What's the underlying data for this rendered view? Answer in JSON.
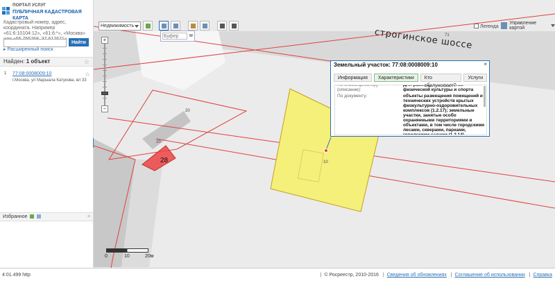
{
  "header": {
    "portal_label": "ПОРТАЛ УСЛУГ",
    "map_title": "ПУБЛИЧНАЯ КАДАСТРОВАЯ КАРТА"
  },
  "search": {
    "hint": "Кадастровый номер, адрес, координата. Например «61:6:10104:12», «61:6:*», «Москва» или «55.755768, 37.617671»",
    "value": "",
    "button_label": "Найти",
    "advanced_label": "Расширенный поиск"
  },
  "results": {
    "found_prefix": "Найден:",
    "found_count": "1 объект",
    "items": [
      {
        "index": "1",
        "cadastral_number": "77:08:0008009:10",
        "address": "г.Москва, ул Маршала Катукова, вл 33"
      }
    ]
  },
  "favorites": {
    "label": "Избранное"
  },
  "toolbar": {
    "layer_select_value": "Недвижимость",
    "buffer_placeholder": "Буфер",
    "buffer_unit": "м"
  },
  "map_controls": {
    "legend_label": "Легенда",
    "management_label": "Управление картой",
    "zoom_in": "+",
    "zoom_out": "−"
  },
  "map": {
    "street_label": "строгинское шоссе",
    "parcel_labels": [
      "20",
      "20",
      "28",
      "10",
      "71"
    ],
    "scale_labels": [
      "0",
      "10",
      "20м"
    ],
    "colors": {
      "selected_parcel": "#f5f07a",
      "highlight_parcel": "#ee4444",
      "boundary": "#e04040",
      "road": "#cfcfcf"
    }
  },
  "popup": {
    "title": "Земельный участок: 77:08:0008009:10",
    "close_label": "×",
    "tabs": [
      "Информация",
      "Характеристики",
      "Кто обслуживает?",
      "Услуги"
    ],
    "active_tab": "Характеристики",
    "rows": [
      {
        "key": "По классификатору (описание):",
        "value": "Для размещения объектов физической культуры и спорта"
      },
      {
        "key": "По документу:",
        "value": "объекты размещения помещений и технических устройств крытых физкультурно-оздоровительных комплексов (1.2.17); земельные участки, занятые особо охраняемыми территориями и объектами, в том числе городскими лесами, скверами, парками, городскими садами (1.2.14)"
      }
    ]
  },
  "status": {
    "left_text": "4:01.499 http",
    "copyright": "© Росреестр, 2010-2016",
    "links": [
      "Сведения об обновлениях",
      "Соглашение об использовании",
      "Справка"
    ]
  }
}
